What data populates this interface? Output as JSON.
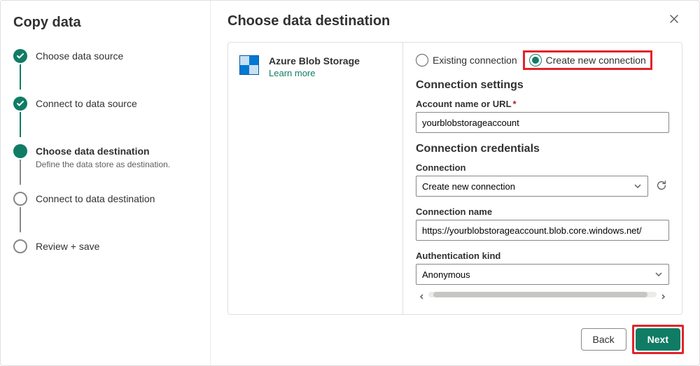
{
  "sidebar": {
    "title": "Copy data",
    "steps": [
      {
        "label": "Choose data source",
        "state": "completed"
      },
      {
        "label": "Connect to data source",
        "state": "completed"
      },
      {
        "label": "Choose data destination",
        "sub": "Define the data store as destination.",
        "state": "active"
      },
      {
        "label": "Connect to data destination",
        "state": "future"
      },
      {
        "label": "Review + save",
        "state": "future"
      }
    ]
  },
  "main": {
    "title": "Choose data destination",
    "destination": {
      "name": "Azure Blob Storage",
      "learn_more": "Learn more"
    },
    "connection_mode": {
      "existing_label": "Existing connection",
      "create_label": "Create new connection",
      "selected": "create"
    },
    "settings": {
      "heading": "Connection settings",
      "account_label": "Account name or URL",
      "account_value": "yourblobstorageaccount"
    },
    "credentials": {
      "heading": "Connection credentials",
      "connection_label": "Connection",
      "connection_value": "Create new connection",
      "name_label": "Connection name",
      "name_value": "https://yourblobstorageaccount.blob.core.windows.net/",
      "auth_label": "Authentication kind",
      "auth_value": "Anonymous"
    }
  },
  "footer": {
    "back": "Back",
    "next": "Next"
  }
}
